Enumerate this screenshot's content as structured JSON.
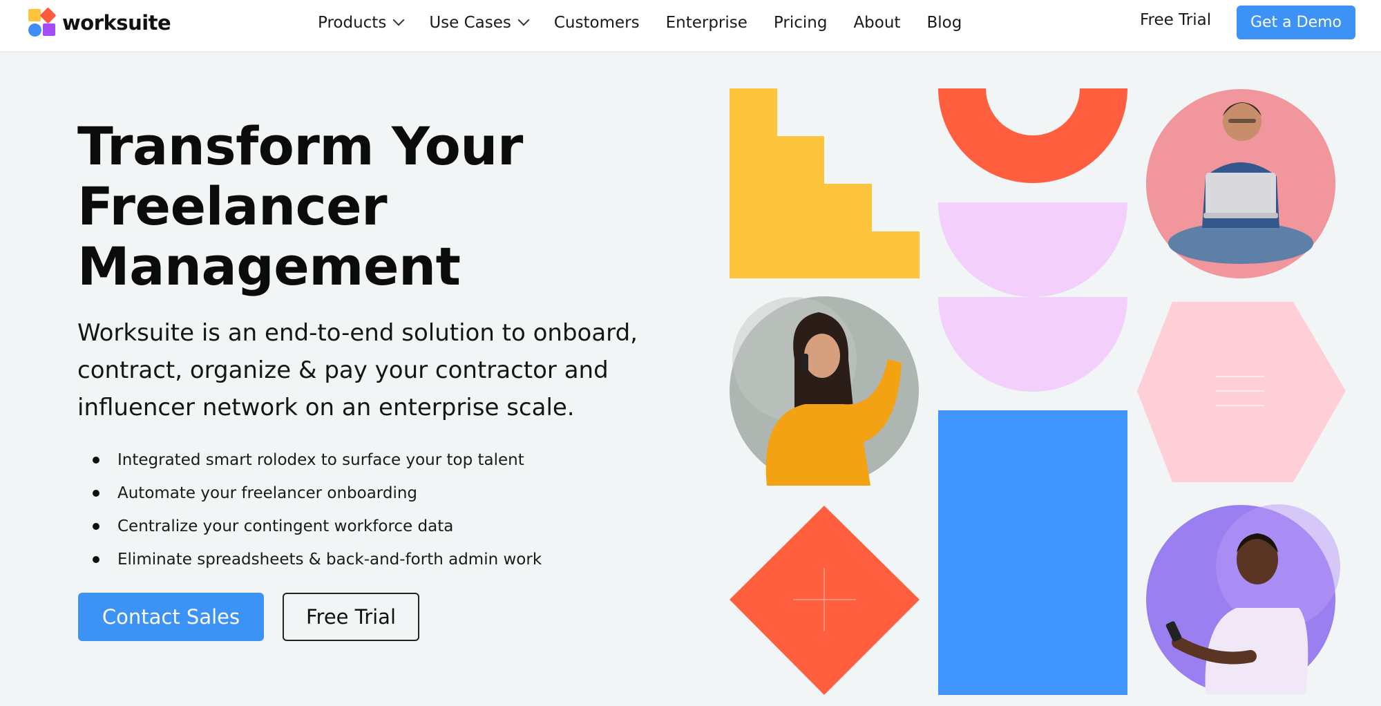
{
  "brand": {
    "name": "worksuite"
  },
  "nav": {
    "items": [
      {
        "label": "Products",
        "dropdown": true
      },
      {
        "label": "Use Cases",
        "dropdown": true
      },
      {
        "label": "Customers",
        "dropdown": false
      },
      {
        "label": "Enterprise",
        "dropdown": false
      },
      {
        "label": "Pricing",
        "dropdown": false
      },
      {
        "label": "About",
        "dropdown": false
      },
      {
        "label": "Blog",
        "dropdown": false
      }
    ],
    "free_trial": "Free Trial",
    "get_demo": "Get a Demo"
  },
  "hero": {
    "title_lines": [
      "Transform Your",
      "Freelancer",
      "Management"
    ],
    "subtitle": "Worksuite is an end-to-end solution to onboard, contract, organize & pay your contractor and influencer network on an enterprise scale.",
    "bullets": [
      "Integrated smart rolodex to surface your top talent",
      "Automate your freelancer onboarding",
      "Centralize your contingent workforce data",
      "Eliminate spreadsheets & back-and-forth admin work"
    ],
    "contact_sales": "Contact Sales",
    "free_trial": "Free Trial"
  },
  "colors": {
    "accent_blue": "#3d93f5",
    "yellow": "#ffc43d",
    "coral": "#ff5f3f",
    "lilac": "#f2d0fb",
    "pink": "#ffcfd8",
    "shape_blue": "#3f95fd"
  }
}
